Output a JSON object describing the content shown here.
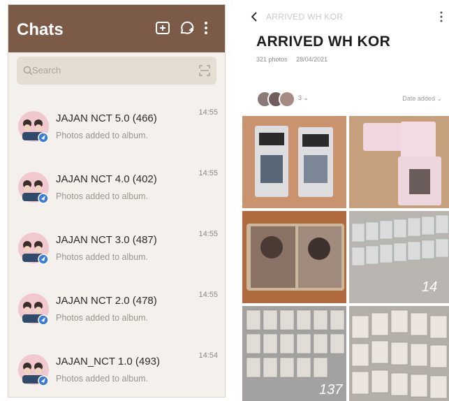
{
  "left_panel": {
    "title": "Chats",
    "search_placeholder": "Search",
    "chats": [
      {
        "name": "JAJAN NCT 5.0 (466)",
        "preview": "Photos added to album.",
        "time": "14:55"
      },
      {
        "name": "JAJAN NCT 4.0 (402)",
        "preview": "Photos added to album.",
        "time": "14:55"
      },
      {
        "name": "JAJAN NCT 3.0 (487)",
        "preview": "Photos added to album.",
        "time": "14:55"
      },
      {
        "name": "JAJAN NCT 2.0 (478)",
        "preview": "Photos added to album.",
        "time": "14:55"
      },
      {
        "name": "JAJAN_NCT 1.0 (493)",
        "preview": "Photos added to album.",
        "time": "14:54"
      }
    ],
    "icons": [
      "video-chat-icon",
      "new-chat-icon",
      "more-icon",
      "search-icon",
      "scan-icon"
    ]
  },
  "right_panel": {
    "breadcrumb": "ARRIVED WH KOR",
    "album_title": "ARRIVED WH KOR",
    "photo_count": "321 photos",
    "date": "28/04/2021",
    "faces_count": "3",
    "sort_label": "Date added",
    "photo_labels": [
      "14",
      "137"
    ]
  },
  "colors": {
    "header_brown": "#7b5a47",
    "chat_bg": "#f4f1ec",
    "search_bg": "#e4ddd4",
    "badge_blue": "#3a7bd5"
  }
}
